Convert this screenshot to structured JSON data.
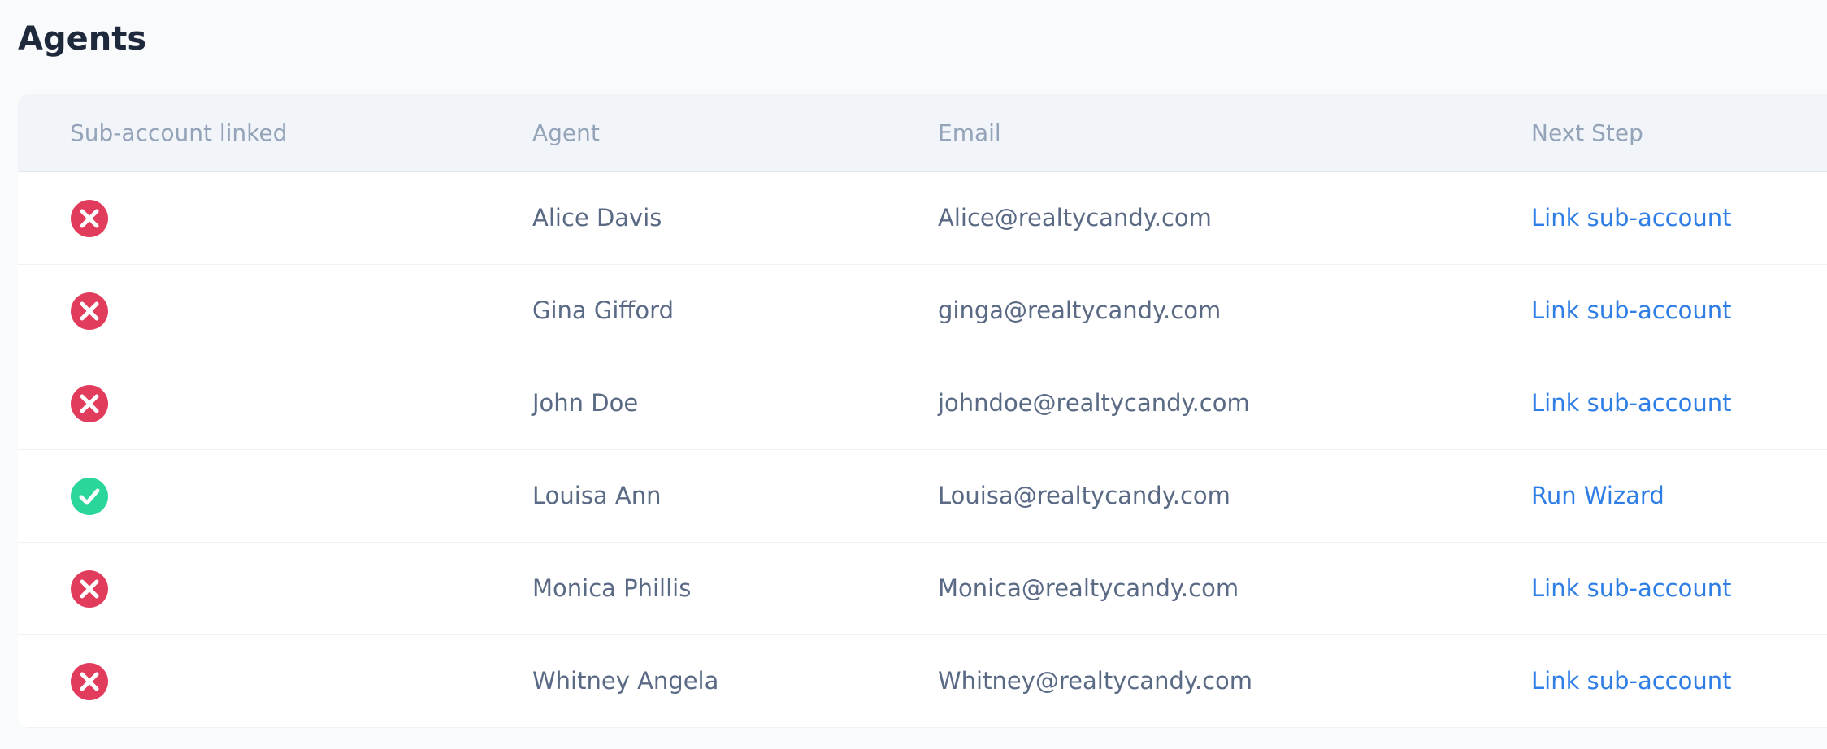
{
  "page": {
    "title": "Agents"
  },
  "table": {
    "columns": [
      "Sub-account linked",
      "Agent",
      "Email",
      "Next Step"
    ],
    "rows": [
      {
        "linked": false,
        "status_icon": "x-circle-icon",
        "agent": "Alice Davis",
        "email": "Alice@realtycandy.com",
        "next_step": "Link sub-account"
      },
      {
        "linked": false,
        "status_icon": "x-circle-icon",
        "agent": "Gina Gifford",
        "email": "ginga@realtycandy.com",
        "next_step": "Link sub-account"
      },
      {
        "linked": false,
        "status_icon": "x-circle-icon",
        "agent": "John Doe",
        "email": "johndoe@realtycandy.com",
        "next_step": "Link sub-account"
      },
      {
        "linked": true,
        "status_icon": "check-circle-icon",
        "agent": "Louisa Ann",
        "email": "Louisa@realtycandy.com",
        "next_step": "Run Wizard"
      },
      {
        "linked": false,
        "status_icon": "x-circle-icon",
        "agent": "Monica Phillis",
        "email": "Monica@realtycandy.com",
        "next_step": "Link sub-account"
      },
      {
        "linked": false,
        "status_icon": "x-circle-icon",
        "agent": "Whitney Angela",
        "email": "Whitney@realtycandy.com",
        "next_step": "Link sub-account"
      }
    ]
  },
  "colors": {
    "not_linked": "#e23c5d",
    "linked": "#2bd69a",
    "link": "#2f7ee6",
    "title": "#1e2a3c",
    "header_text": "#94a3b8",
    "body_text": "#5a6a85"
  }
}
